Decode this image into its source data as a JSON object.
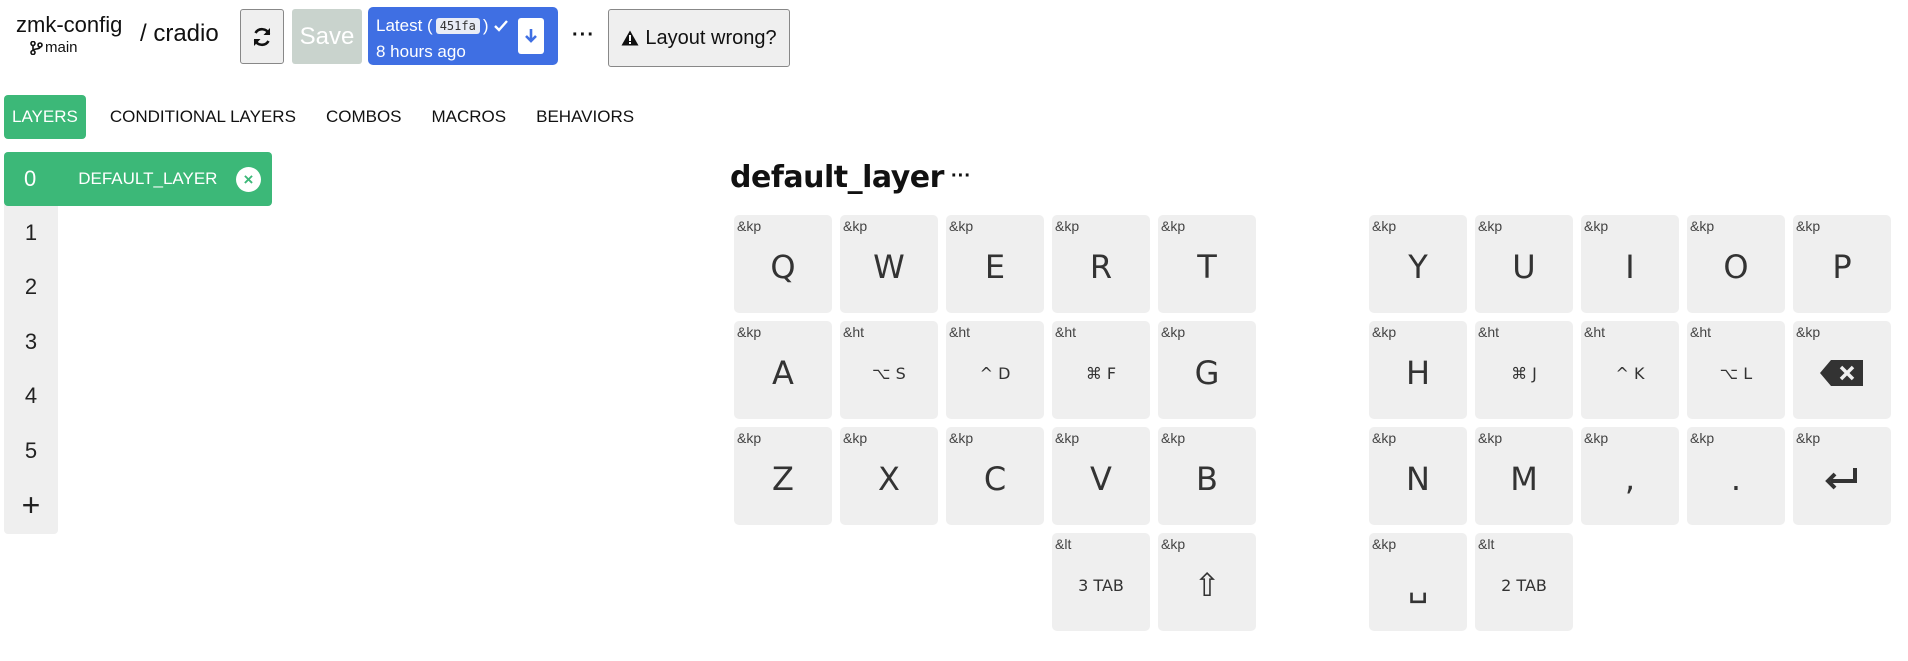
{
  "header": {
    "repo": "zmk-config",
    "branch": "main",
    "keyboard": "/ cradio",
    "save_label": "Save",
    "version_prefix": "Latest (",
    "commit": "451fa",
    "version_suffix": ")",
    "version_time": "8 hours ago",
    "more": "···",
    "layout_wrong": "Layout wrong?"
  },
  "tabs": [
    "LAYERS",
    "CONDITIONAL LAYERS",
    "COMBOS",
    "MACROS",
    "BEHAVIORS"
  ],
  "layers": {
    "active_index": "0",
    "active_name": "DEFAULT_LAYER",
    "close": "×",
    "others": [
      "1",
      "2",
      "3",
      "4",
      "5"
    ],
    "add": "+"
  },
  "layer_title": "default_layer",
  "layer_more": "···",
  "keys": [
    {
      "b": "&kp",
      "l": "Q"
    },
    {
      "b": "&kp",
      "l": "W"
    },
    {
      "b": "&kp",
      "l": "E"
    },
    {
      "b": "&kp",
      "l": "R"
    },
    {
      "b": "&kp",
      "l": "T"
    },
    {
      "b": "&kp",
      "l": "Y"
    },
    {
      "b": "&kp",
      "l": "U"
    },
    {
      "b": "&kp",
      "l": "I"
    },
    {
      "b": "&kp",
      "l": "O"
    },
    {
      "b": "&kp",
      "l": "P"
    },
    {
      "b": "&kp",
      "l": "A"
    },
    {
      "b": "&ht",
      "l": "⌥ S"
    },
    {
      "b": "&ht",
      "l": "^ D"
    },
    {
      "b": "&ht",
      "l": "⌘ F"
    },
    {
      "b": "&kp",
      "l": "G"
    },
    {
      "b": "&kp",
      "l": "H"
    },
    {
      "b": "&ht",
      "l": "⌘ J"
    },
    {
      "b": "&ht",
      "l": "^ K"
    },
    {
      "b": "&ht",
      "l": "⌥ L"
    },
    {
      "b": "&kp",
      "l": "",
      "icon": "backspace-icon"
    },
    {
      "b": "&kp",
      "l": "Z"
    },
    {
      "b": "&kp",
      "l": "X"
    },
    {
      "b": "&kp",
      "l": "C"
    },
    {
      "b": "&kp",
      "l": "V"
    },
    {
      "b": "&kp",
      "l": "B"
    },
    {
      "b": "&kp",
      "l": "N"
    },
    {
      "b": "&kp",
      "l": "M"
    },
    {
      "b": "&kp",
      "l": ","
    },
    {
      "b": "&kp",
      "l": "."
    },
    {
      "b": "&kp",
      "l": "",
      "icon": "enter-icon"
    },
    {
      "b": "&lt",
      "l": "3 TAB"
    },
    {
      "b": "&kp",
      "l": "⇧"
    },
    {
      "b": "&kp",
      "l": "␣"
    },
    {
      "b": "&lt",
      "l": "2 TAB"
    }
  ],
  "colors": {
    "accent_green": "#3cb878",
    "version_blue": "#3f6fe3",
    "key_bg": "#efefef",
    "save_disabled": "#c9d3cd"
  }
}
